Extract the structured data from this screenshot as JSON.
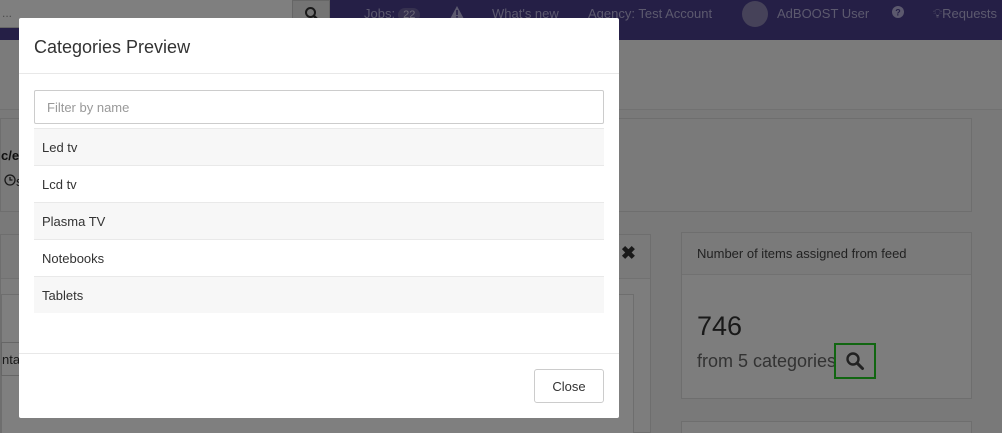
{
  "topbar": {
    "search_text": "...",
    "jobs_label": "Jobs:",
    "jobs_count": "22",
    "whats_new": "What's new",
    "agency": "Agency: Test Account",
    "user": "AdBOOST User",
    "requests": "Requests",
    "colors": {
      "bar": "#4a3f8c"
    }
  },
  "background": {
    "fragment_1": "c/e",
    "fragment_2": "s",
    "fragment_3": "nta",
    "items_panel": {
      "heading": "Number of items assigned from feed",
      "count": "746",
      "subtitle": "from 5 categories",
      "search_icon": "magnifier-icon"
    }
  },
  "modal": {
    "title": "Categories Preview",
    "filter_placeholder": "Filter by name",
    "filter_value": "",
    "categories": [
      "Led tv",
      "Lcd tv",
      "Plasma TV",
      "Notebooks",
      "Tablets"
    ],
    "close_label": "Close"
  }
}
